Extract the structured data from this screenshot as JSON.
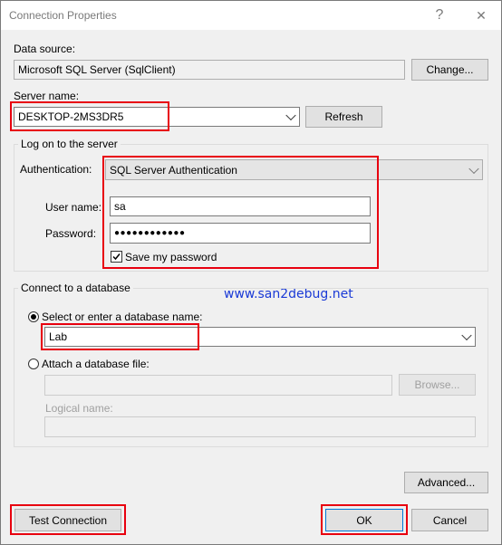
{
  "window": {
    "title": "Connection Properties",
    "help_glyph": "?",
    "close_glyph": "✕"
  },
  "data_source": {
    "label": "Data source:",
    "value": "Microsoft SQL Server (SqlClient)",
    "change_label": "Change..."
  },
  "server": {
    "label": "Server name:",
    "value": "DESKTOP-2MS3DR5",
    "refresh_label": "Refresh"
  },
  "logon": {
    "group_title": "Log on to the server",
    "auth_label": "Authentication:",
    "auth_value": "SQL Server Authentication",
    "user_label": "User name:",
    "user_value": "sa",
    "password_label": "Password:",
    "password_mask": "●●●●●●●●●●●●",
    "save_password_label": "Save my password",
    "save_password_checked": true
  },
  "watermark": "www.san2debug.net",
  "database": {
    "group_title": "Connect to a database",
    "select_option_label": "Select or enter a database name:",
    "select_option_checked": true,
    "database_value": "Lab",
    "attach_option_label": "Attach a database file:",
    "attach_option_checked": false,
    "browse_label": "Browse...",
    "logical_name_label": "Logical name:"
  },
  "buttons": {
    "advanced": "Advanced...",
    "test_connection": "Test Connection",
    "ok": "OK",
    "cancel": "Cancel"
  },
  "colors": {
    "highlight_box": "#e8000f",
    "watermark": "#1a3ad6",
    "dialog_bg": "#f0f0f0"
  }
}
